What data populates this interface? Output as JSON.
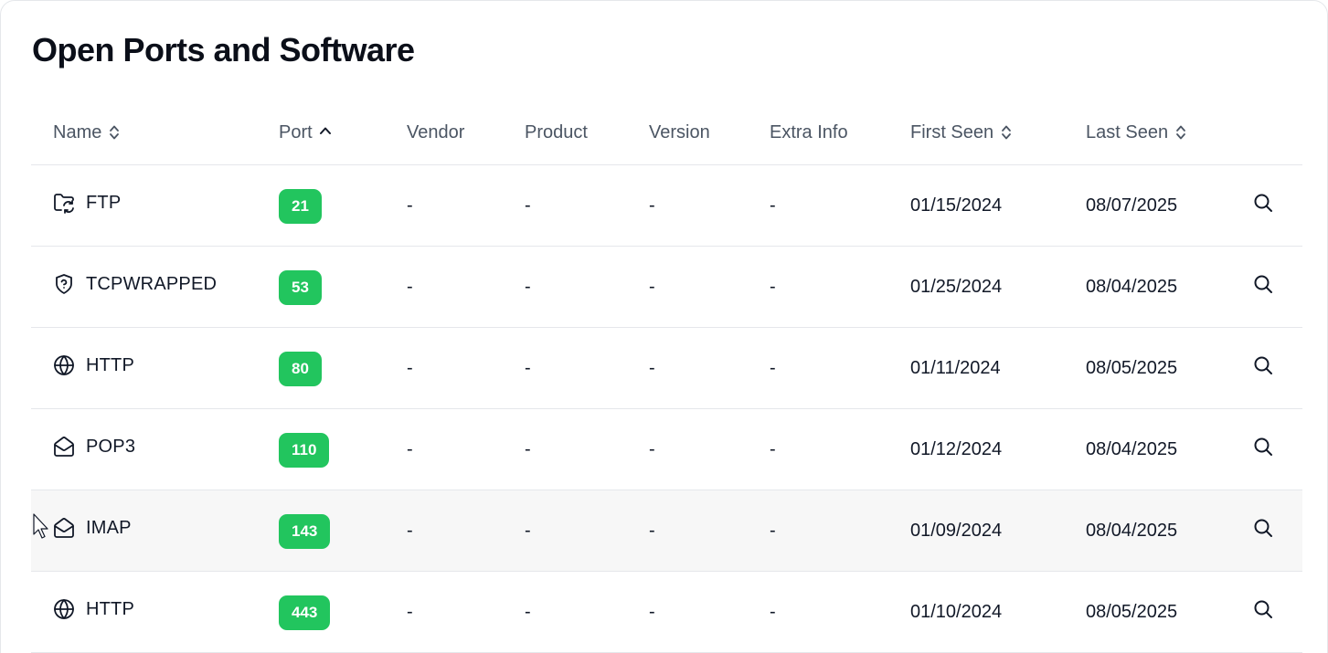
{
  "title": "Open Ports and Software",
  "columns": {
    "name": "Name",
    "port": "Port",
    "vendor": "Vendor",
    "product": "Product",
    "version": "Version",
    "extra_info": "Extra Info",
    "first_seen": "First Seen",
    "last_seen": "Last Seen"
  },
  "sort": {
    "column": "port",
    "direction": "ascending"
  },
  "colors": {
    "port_badge": "#22c55e",
    "hover_row": "#f7f7f7",
    "divider": "#e5e7eb"
  },
  "rows": [
    {
      "icon": "folder-sync-icon",
      "name": "FTP",
      "port": "21",
      "vendor": "-",
      "product": "-",
      "version": "-",
      "extra_info": "-",
      "first_seen": "01/15/2024",
      "last_seen": "08/07/2025"
    },
    {
      "icon": "shield-question-icon",
      "name": "TCPWRAPPED",
      "port": "53",
      "vendor": "-",
      "product": "-",
      "version": "-",
      "extra_info": "-",
      "first_seen": "01/25/2024",
      "last_seen": "08/04/2025"
    },
    {
      "icon": "globe-icon",
      "name": "HTTP",
      "port": "80",
      "vendor": "-",
      "product": "-",
      "version": "-",
      "extra_info": "-",
      "first_seen": "01/11/2024",
      "last_seen": "08/05/2025"
    },
    {
      "icon": "mail-open-icon",
      "name": "POP3",
      "port": "110",
      "vendor": "-",
      "product": "-",
      "version": "-",
      "extra_info": "-",
      "first_seen": "01/12/2024",
      "last_seen": "08/04/2025"
    },
    {
      "icon": "mail-open-icon",
      "name": "IMAP",
      "port": "143",
      "vendor": "-",
      "product": "-",
      "version": "-",
      "extra_info": "-",
      "first_seen": "01/09/2024",
      "last_seen": "08/04/2025"
    },
    {
      "icon": "globe-icon",
      "name": "HTTP",
      "port": "443",
      "vendor": "-",
      "product": "-",
      "version": "-",
      "extra_info": "-",
      "first_seen": "01/10/2024",
      "last_seen": "08/05/2025"
    }
  ]
}
